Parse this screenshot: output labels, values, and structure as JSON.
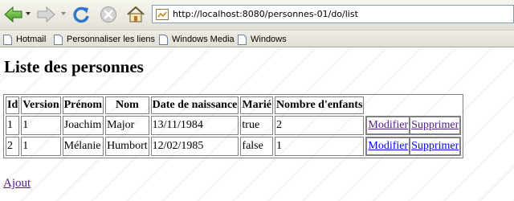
{
  "toolbar": {
    "back_icon": "back-arrow-icon",
    "forward_icon": "forward-arrow-icon",
    "reload_icon": "reload-icon",
    "stop_icon": "stop-icon",
    "home_icon": "home-icon",
    "address_url": "http://localhost:8080/personnes-01/do/list"
  },
  "bookmarks": [
    {
      "label": "Hotmail"
    },
    {
      "label": "Personnaliser les liens"
    },
    {
      "label": "Windows Media"
    },
    {
      "label": "Windows"
    }
  ],
  "page": {
    "title": "Liste des personnes",
    "table": {
      "headers": [
        "Id",
        "Version",
        "Prénom",
        "Nom",
        "Date de naissance",
        "Marié",
        "Nombre d'enfants"
      ],
      "rows": [
        {
          "id": "1",
          "version": "1",
          "prenom": "Joachim",
          "nom": "Major",
          "date": "13/11/1984",
          "marie": "true",
          "enfants": "2",
          "modify": "Modifier",
          "delete": "Supprimer"
        },
        {
          "id": "2",
          "version": "1",
          "prenom": "Mélanie",
          "nom": "Humbort",
          "date": "12/02/1985",
          "marie": "false",
          "enfants": "1",
          "modify": "Modifier",
          "delete": "Supprimer"
        }
      ]
    },
    "add_label": "Ajout"
  },
  "colors": {
    "link": "#0000ee",
    "visited_link": "#551a8b",
    "toolbar_bg": "#ece9d8"
  }
}
